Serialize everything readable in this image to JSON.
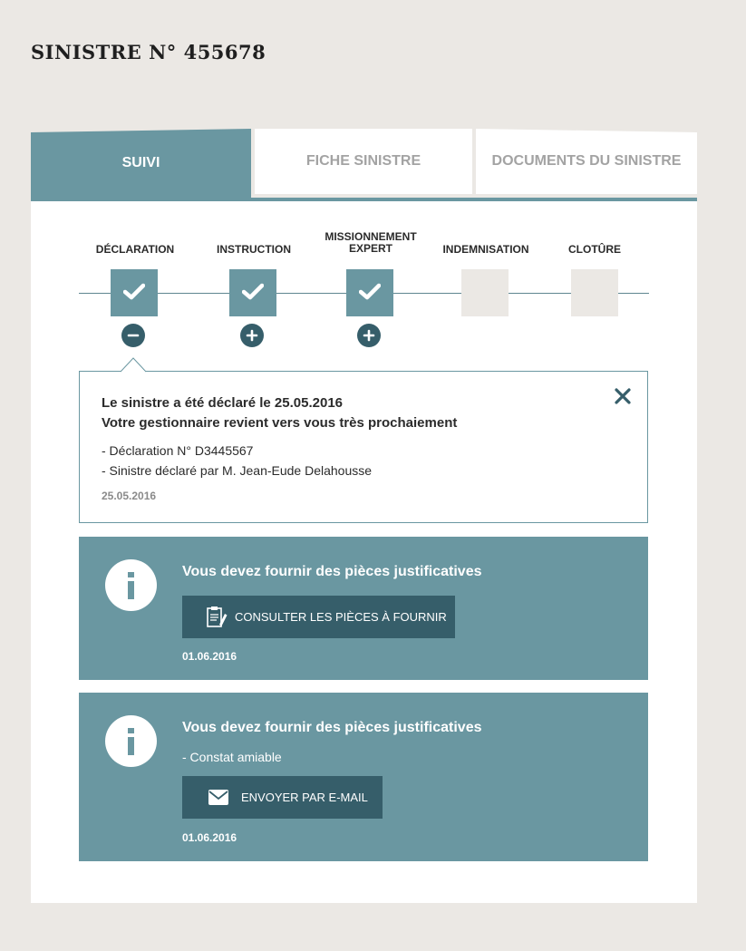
{
  "page": {
    "title": "SINISTRE N° 455678"
  },
  "tabs": [
    {
      "label": "SUIVI",
      "active": true
    },
    {
      "label": "FICHE SINISTRE",
      "active": false
    },
    {
      "label": "DOCUMENTS DU SINISTRE",
      "active": false
    }
  ],
  "steps": [
    {
      "label": "DÉCLARATION",
      "done": true,
      "toggle": "minus"
    },
    {
      "label": "INSTRUCTION",
      "done": true,
      "toggle": "plus"
    },
    {
      "label_line1": "MISSIONNEMENT",
      "label_line2": "EXPERT",
      "done": true,
      "toggle": "plus"
    },
    {
      "label": "INDEMNISATION",
      "done": false
    },
    {
      "label": "CLOTÛRE",
      "done": false
    }
  ],
  "detail": {
    "title_line1": "Le sinistre  a été déclaré le 25.05.2016",
    "title_line2": "Votre gestionnaire revient vers vous très prochaiement",
    "lines": [
      "- Déclaration N° D3445567",
      "- Sinistre déclaré par M. Jean-Eude Delahousse"
    ],
    "date": "25.05.2016"
  },
  "notices": [
    {
      "title": "Vous devez fournir des pièces justificatives",
      "button_label": "CONSULTER LES PIÈCES À FOURNIR",
      "button_icon": "clipboard-icon",
      "date": "01.06.2016"
    },
    {
      "title": "Vous devez fournir des pièces justificatives",
      "subtitle": "- Constat amiable",
      "button_label": "ENVOYER PAR E-MAIL",
      "button_icon": "envelope-icon",
      "date": "01.06.2016"
    }
  ],
  "colors": {
    "background": "#ebe8e4",
    "accent": "#6a97a1",
    "dark_accent": "#365e6a",
    "step_todo": "#ebe8e4"
  }
}
